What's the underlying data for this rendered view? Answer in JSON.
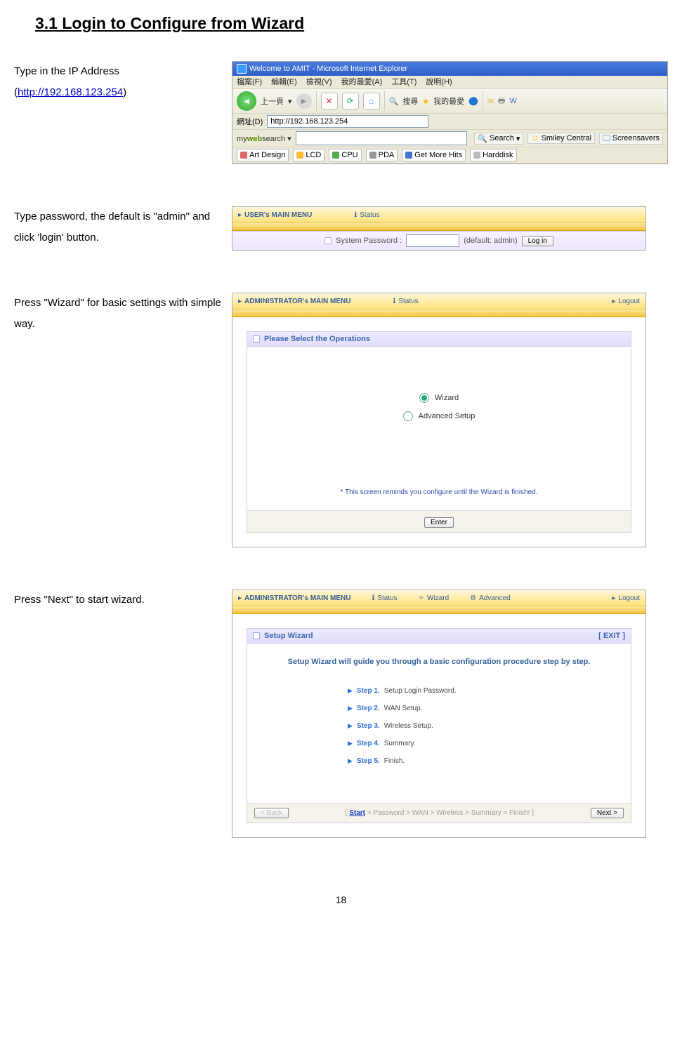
{
  "section_title": "3.1 Login to Configure from Wizard",
  "step1": {
    "text_before_link": "Type in the IP Address (",
    "link_text": "http://192.168.123.254",
    "text_after_link": ")"
  },
  "browser": {
    "title": "Welcome to AMIT - Microsoft Internet Explorer",
    "menu_file": "檔案(F)",
    "menu_edit": "編輯(E)",
    "menu_view": "檢視(V)",
    "menu_fav": "我的最愛(A)",
    "menu_tools": "工具(T)",
    "menu_help": "說明(H)",
    "back_label": "上一頁",
    "search_label": "搜尋",
    "fav_label": "我的最愛",
    "addr_label": "網址(D)",
    "addr_value": "http://192.168.123.254",
    "mws_brand_pre": "my",
    "mws_brand_bold": "web",
    "mws_brand_post": "search",
    "mws_search_btn": "Search",
    "mws_smiley": "Smiley Central",
    "mws_ss": "Screensavers",
    "links": {
      "art": "Art Design",
      "lcd": "LCD",
      "cpu": "CPU",
      "pda": "PDA",
      "hits": "Get More Hits",
      "hdd": "Harddisk"
    }
  },
  "step2_text": "Type password, the default is \"admin\" and click 'login' button.",
  "user_menu_title": "USER's MAIN MENU",
  "nav_status": "Status",
  "login": {
    "label": "System Password :",
    "hint": "(default: admin)",
    "button": "Log in"
  },
  "step3_text": "Press \"Wizard\" for basic settings with simple way.",
  "admin_menu_title": "ADMINISTRATOR's MAIN MENU",
  "nav_logout": "Logout",
  "ops_panel_title": "Please Select the Operations",
  "ops_wizard": "Wizard",
  "ops_advanced": "Advanced Setup",
  "ops_reminder": "* This screen reminds you configure until the Wizard is finished.",
  "ops_enter": "Enter",
  "step4_text": "Press \"Next\" to start wizard.",
  "nav_wizard": "Wizard",
  "nav_advanced": "Advanced",
  "wiz_panel_title": "Setup Wizard",
  "wiz_exit": "[ EXIT ]",
  "wiz_lead": "Setup Wizard will guide you through a basic configuration procedure step by step.",
  "wiz_steps": {
    "s1b": "Step 1.",
    "s1": "Setup Login Password.",
    "s2b": "Step 2.",
    "s2": "WAN Setup.",
    "s3b": "Step 3.",
    "s3": "Wireless Setup.",
    "s4b": "Step 4.",
    "s4": "Summary.",
    "s5b": "Step 5.",
    "s5": "Finish."
  },
  "wiz_back": "< Back",
  "wiz_crumb_open": "[ ",
  "wiz_crumb_start": "Start",
  "wiz_crumb_rest": " > Password > WAN > Wireless > Summary > Finish! ]",
  "wiz_next": "Next >",
  "page_number": "18"
}
